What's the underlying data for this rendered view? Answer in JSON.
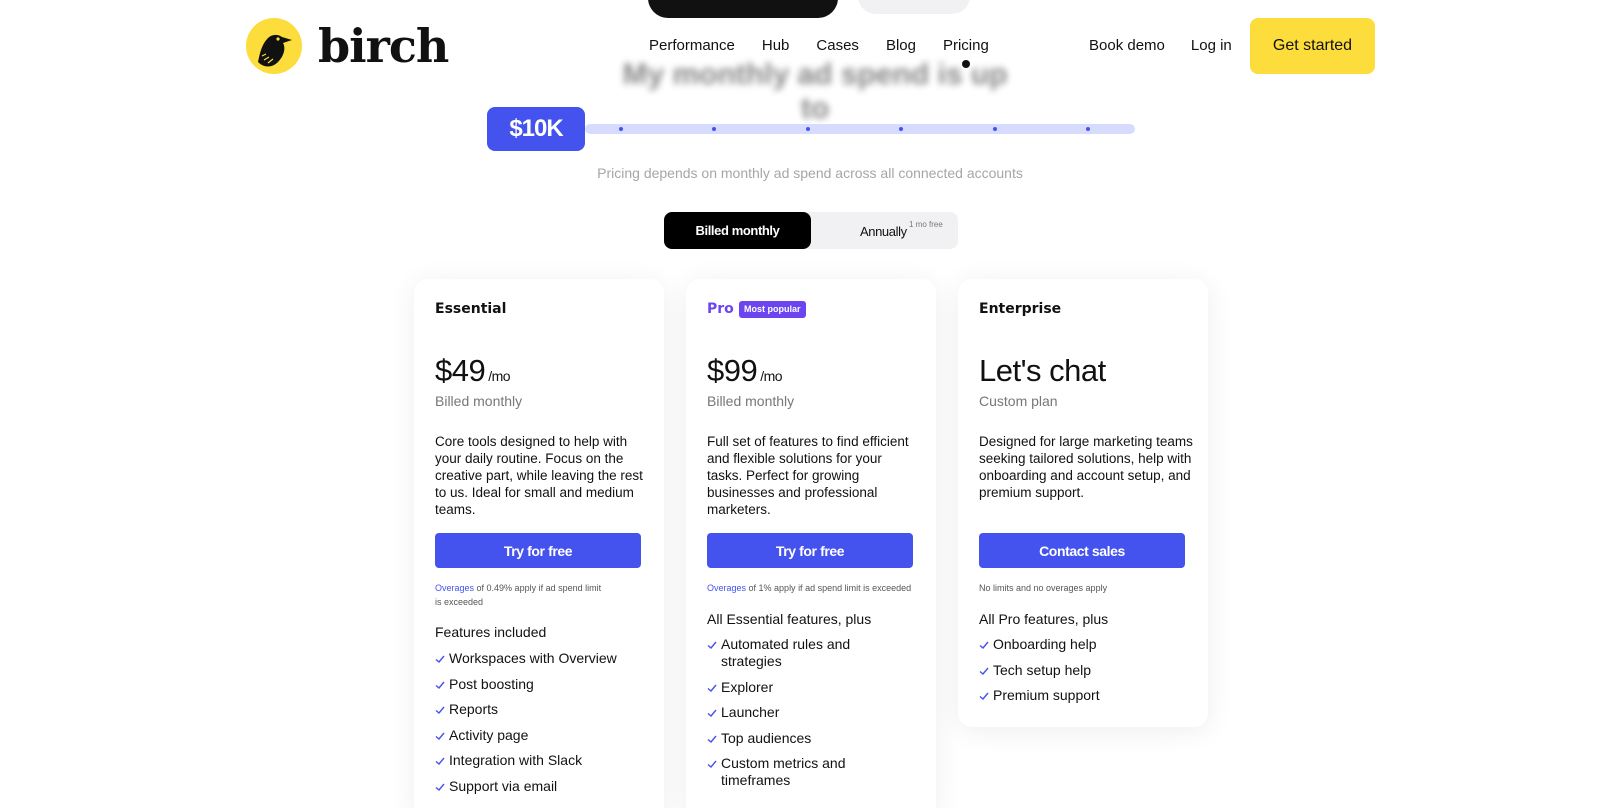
{
  "brand": {
    "name": "birch",
    "accent": "#4453ee",
    "yellow": "#fddd3b",
    "purple": "#6d45f0"
  },
  "nav": {
    "items": [
      "Performance",
      "Hub",
      "Cases",
      "Blog",
      "Pricing"
    ],
    "active": "Pricing",
    "book_demo": "Book demo",
    "log_in": "Log in",
    "cta": "Get started"
  },
  "hero": {
    "heading": "My monthly ad spend is up to",
    "slider_value": "$10K",
    "note": "Pricing depends on monthly ad spend across all connected accounts"
  },
  "billing": {
    "monthly": "Billed monthly",
    "annually": "Annually",
    "annual_note": "1 mo free",
    "selected": "monthly"
  },
  "plans": [
    {
      "name": "Essential",
      "price": "$49",
      "period": "/mo",
      "billed": "Billed monthly",
      "description": "Core tools designed to help with your daily routine. Focus on the creative part, while leaving the rest to us. Ideal for small and medium teams.",
      "button": "Try for free",
      "overage_link": "Overages",
      "overage_text": " of 0.49% apply if ad spend limit is exceeded",
      "features_heading": "Features included",
      "features": [
        "Workspaces with Overview",
        "Post boosting",
        "Reports",
        "Activity page",
        "Integration with Slack",
        "Support via email"
      ]
    },
    {
      "name": "Pro",
      "badge": "Most popular",
      "price": "$99",
      "period": "/mo",
      "billed": "Billed monthly",
      "description": "Full set of features to find efficient and flexible solutions for your tasks. Perfect for growing businesses and professional marketers.",
      "button": "Try for free",
      "overage_link": "Overages",
      "overage_text": " of 1% apply if ad spend limit is exceeded",
      "features_heading": "All Essential features, plus",
      "features": [
        "Automated rules and strategies",
        "Explorer",
        "Launcher",
        "Top audiences",
        "Custom metrics and timeframes"
      ]
    },
    {
      "name": "Enterprise",
      "price": "Let's chat",
      "billed": "Custom plan",
      "description": "Designed for large marketing teams seeking tailored solutions, help with onboarding and account setup, and premium support.",
      "button": "Contact sales",
      "overage_text": "No limits and no overages apply",
      "features_heading": "All Pro features, plus",
      "features": [
        "Onboarding help",
        "Tech setup help",
        "Premium support"
      ]
    }
  ]
}
